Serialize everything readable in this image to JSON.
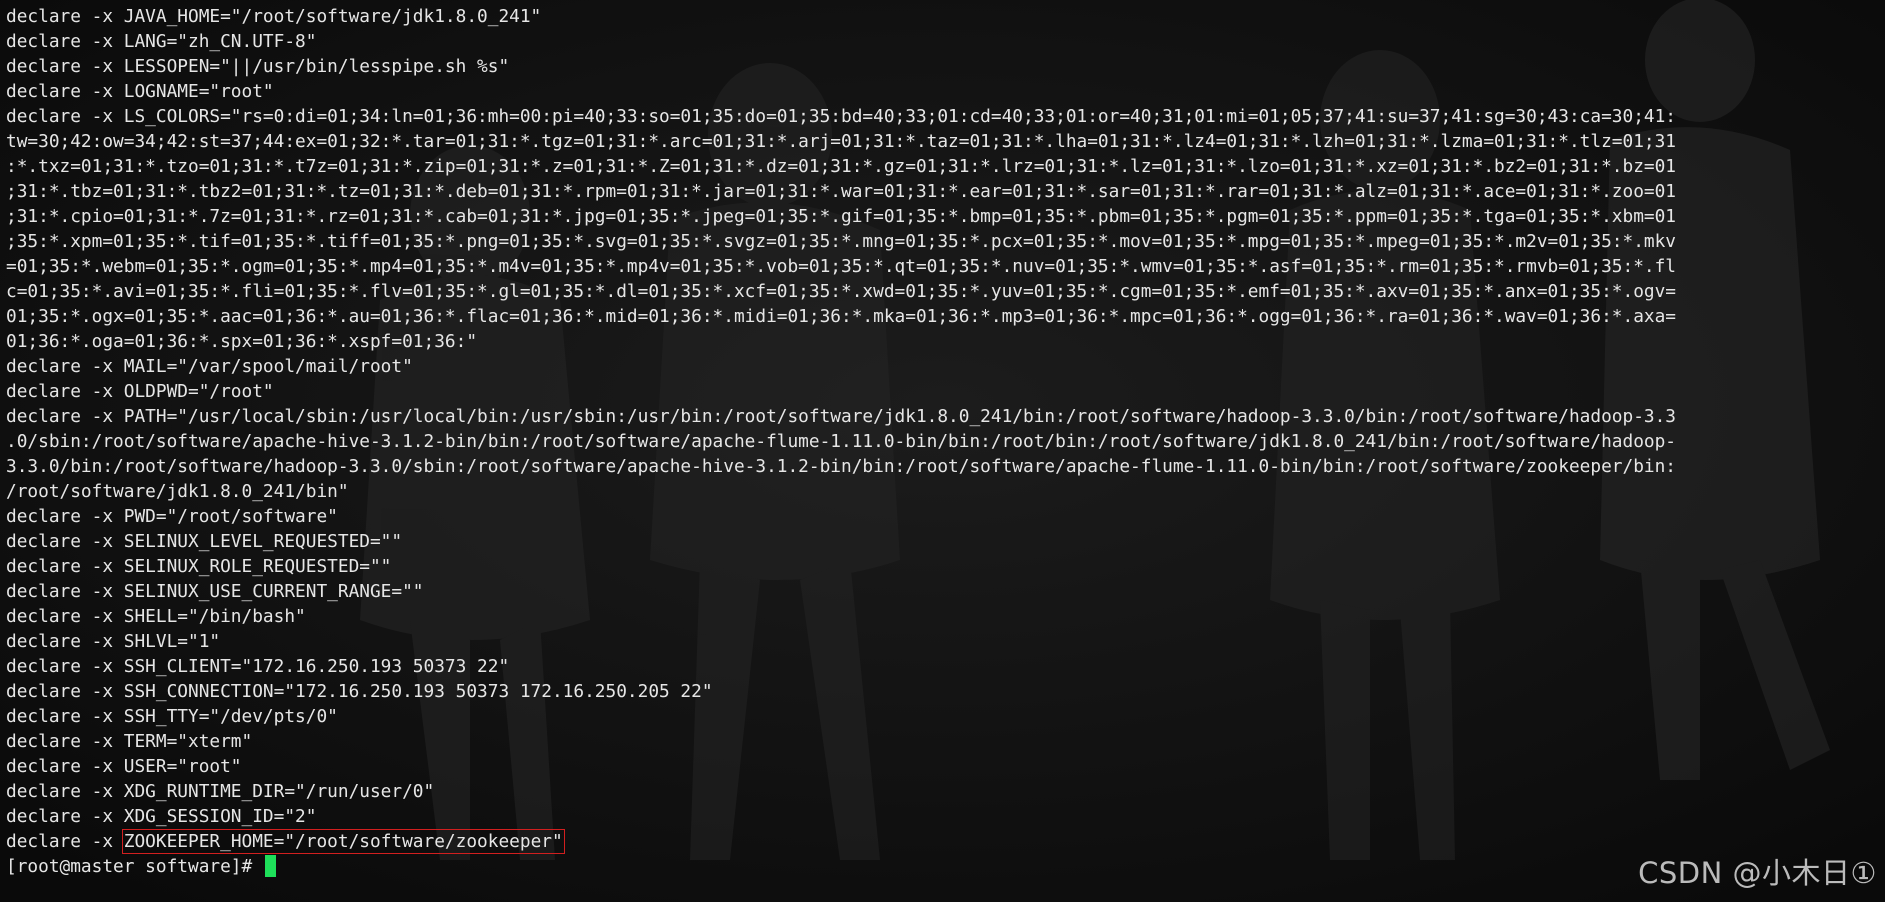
{
  "terminal": {
    "lines": [
      "declare -x JAVA_HOME=\"/root/software/jdk1.8.0_241\"",
      "declare -x LANG=\"zh_CN.UTF-8\"",
      "declare -x LESSOPEN=\"||/usr/bin/lesspipe.sh %s\"",
      "declare -x LOGNAME=\"root\"",
      "declare -x LS_COLORS=\"rs=0:di=01;34:ln=01;36:mh=00:pi=40;33:so=01;35:do=01;35:bd=40;33;01:cd=40;33;01:or=40;31;01:mi=01;05;37;41:su=37;41:sg=30;43:ca=30;41:",
      "tw=30;42:ow=34;42:st=37;44:ex=01;32:*.tar=01;31:*.tgz=01;31:*.arc=01;31:*.arj=01;31:*.taz=01;31:*.lha=01;31:*.lz4=01;31:*.lzh=01;31:*.lzma=01;31:*.tlz=01;31",
      ":*.txz=01;31:*.tzo=01;31:*.t7z=01;31:*.zip=01;31:*.z=01;31:*.Z=01;31:*.dz=01;31:*.gz=01;31:*.lrz=01;31:*.lz=01;31:*.lzo=01;31:*.xz=01;31:*.bz2=01;31:*.bz=01",
      ";31:*.tbz=01;31:*.tbz2=01;31:*.tz=01;31:*.deb=01;31:*.rpm=01;31:*.jar=01;31:*.war=01;31:*.ear=01;31:*.sar=01;31:*.rar=01;31:*.alz=01;31:*.ace=01;31:*.zoo=01",
      ";31:*.cpio=01;31:*.7z=01;31:*.rz=01;31:*.cab=01;31:*.jpg=01;35:*.jpeg=01;35:*.gif=01;35:*.bmp=01;35:*.pbm=01;35:*.pgm=01;35:*.ppm=01;35:*.tga=01;35:*.xbm=01",
      ";35:*.xpm=01;35:*.tif=01;35:*.tiff=01;35:*.png=01;35:*.svg=01;35:*.svgz=01;35:*.mng=01;35:*.pcx=01;35:*.mov=01;35:*.mpg=01;35:*.mpeg=01;35:*.m2v=01;35:*.mkv",
      "=01;35:*.webm=01;35:*.ogm=01;35:*.mp4=01;35:*.m4v=01;35:*.mp4v=01;35:*.vob=01;35:*.qt=01;35:*.nuv=01;35:*.wmv=01;35:*.asf=01;35:*.rm=01;35:*.rmvb=01;35:*.fl",
      "c=01;35:*.avi=01;35:*.fli=01;35:*.flv=01;35:*.gl=01;35:*.dl=01;35:*.xcf=01;35:*.xwd=01;35:*.yuv=01;35:*.cgm=01;35:*.emf=01;35:*.axv=01;35:*.anx=01;35:*.ogv=",
      "01;35:*.ogx=01;35:*.aac=01;36:*.au=01;36:*.flac=01;36:*.mid=01;36:*.midi=01;36:*.mka=01;36:*.mp3=01;36:*.mpc=01;36:*.ogg=01;36:*.ra=01;36:*.wav=01;36:*.axa=",
      "01;36:*.oga=01;36:*.spx=01;36:*.xspf=01;36:\"",
      "declare -x MAIL=\"/var/spool/mail/root\"",
      "declare -x OLDPWD=\"/root\"",
      "declare -x PATH=\"/usr/local/sbin:/usr/local/bin:/usr/sbin:/usr/bin:/root/software/jdk1.8.0_241/bin:/root/software/hadoop-3.3.0/bin:/root/software/hadoop-3.3",
      ".0/sbin:/root/software/apache-hive-3.1.2-bin/bin:/root/software/apache-flume-1.11.0-bin/bin:/root/bin:/root/software/jdk1.8.0_241/bin:/root/software/hadoop-",
      "3.3.0/bin:/root/software/hadoop-3.3.0/sbin:/root/software/apache-hive-3.1.2-bin/bin:/root/software/apache-flume-1.11.0-bin/bin:/root/software/zookeeper/bin:",
      "/root/software/jdk1.8.0_241/bin\"",
      "declare -x PWD=\"/root/software\"",
      "declare -x SELINUX_LEVEL_REQUESTED=\"\"",
      "declare -x SELINUX_ROLE_REQUESTED=\"\"",
      "declare -x SELINUX_USE_CURRENT_RANGE=\"\"",
      "declare -x SHELL=\"/bin/bash\"",
      "declare -x SHLVL=\"1\"",
      "declare -x SSH_CLIENT=\"172.16.250.193 50373 22\"",
      "declare -x SSH_CONNECTION=\"172.16.250.193 50373 172.16.250.205 22\"",
      "declare -x SSH_TTY=\"/dev/pts/0\"",
      "declare -x TERM=\"xterm\"",
      "declare -x USER=\"root\"",
      "declare -x XDG_RUNTIME_DIR=\"/run/user/0\"",
      "declare -x XDG_SESSION_ID=\"2\""
    ],
    "highlight_prefix": "declare -x ",
    "highlight_text": "ZOOKEEPER_HOME=\"/root/software/zookeeper\"",
    "prompt": "[root@master software]# ",
    "cursor_color": "#1ee05a",
    "highlight_color": "#d21f1f",
    "text_color": "#e6e6e6",
    "background_color": "#0d0d0d"
  },
  "watermark": {
    "text": "CSDN @小木日①"
  }
}
